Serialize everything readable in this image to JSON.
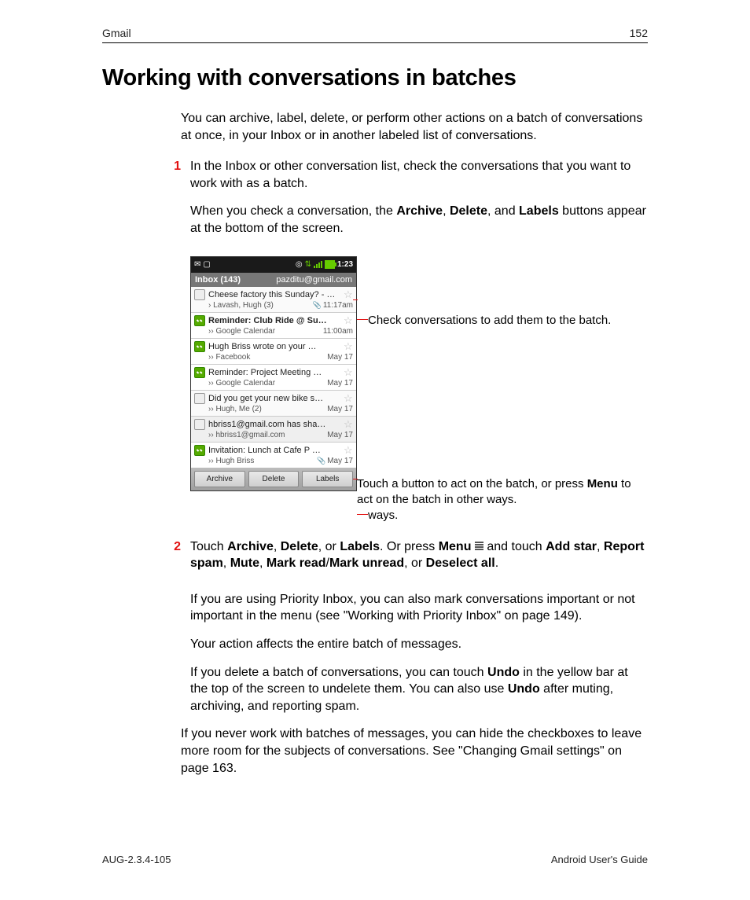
{
  "header": {
    "section": "Gmail",
    "page_number": "152"
  },
  "title": "Working with conversations in batches",
  "intro": "You can archive, label, delete, or perform other actions on a batch of conversations at once, in your Inbox or in another labeled list of conversations.",
  "step1": {
    "num": "1",
    "text": "In the Inbox or other conversation list, check the conversations that you want to work with as a batch.",
    "follow_a": "When you check a conversation, the ",
    "follow_b": "Archive",
    "follow_c": ", ",
    "follow_d": "Delete",
    "follow_e": ", and ",
    "follow_f": "Labels",
    "follow_g": " buttons appear at the bottom of the screen."
  },
  "callouts": {
    "c1": "Check conversations to add them to the batch.",
    "c2a": "Touch a button to act on the batch, or press ",
    "c2b": "Menu",
    "c2c": " to act on the batch in other ways."
  },
  "step2": {
    "num": "2",
    "a": "Touch ",
    "b": "Archive",
    "c": ", ",
    "d": "Delete",
    "e": ", or ",
    "f": "Labels",
    "g": ". Or press ",
    "h": "Menu",
    "i": " ",
    "j": " and touch ",
    "k": "Add star",
    "l": ", ",
    "m": "Report spam",
    "n": ", ",
    "o": "Mute",
    "p": ", ",
    "q": "Mark read",
    "r": "/",
    "s": "Mark unread",
    "t": ", or ",
    "u": "Deselect all",
    "v": "."
  },
  "after1": "If you are using Priority Inbox, you can also mark conversations important or not important in the menu (see \"Working with Priority Inbox\" on page 149).",
  "after2": "Your action affects the entire batch of messages.",
  "after3a": "If you delete a batch of conversations, you can touch ",
  "after3b": "Undo",
  "after3c": " in the yellow bar at the top of the screen to undelete them. You can also use ",
  "after3d": "Undo",
  "after3e": " after muting, archiving, and reporting spam.",
  "tail": "If you never work with batches of messages, you can hide the checkboxes to leave more room for the subjects of conversations. See \"Changing Gmail settings\" on page 163.",
  "footer": {
    "left": "AUG-2.3.4-105",
    "right": "Android User's Guide"
  },
  "phone": {
    "time": "1:23",
    "inbox_label": "Inbox (143)",
    "account": "pazditu@gmail.com",
    "rows": [
      {
        "checked": false,
        "bold": false,
        "subject": "Cheese factory this Sunday? - …",
        "from": "› Lavash, Hugh (3)",
        "time": "11:17am",
        "clip": true,
        "mark": true
      },
      {
        "checked": true,
        "bold": true,
        "subject": "Reminder: Club Ride @ Su…",
        "from": "›› Google Calendar",
        "time": "11:00am",
        "clip": false,
        "mark": false
      },
      {
        "checked": true,
        "bold": false,
        "subject": "Hugh Briss wrote on your …",
        "from": "›› Facebook",
        "time": "May 17",
        "clip": false,
        "mark": false
      },
      {
        "checked": true,
        "bold": false,
        "subject": "Reminder: Project Meeting …",
        "from": "›› Google Calendar",
        "time": "May 17",
        "clip": false,
        "mark": false
      },
      {
        "checked": false,
        "bold": false,
        "subject": "Did you get your new bike s…",
        "from": "›› Hugh, Me (2)",
        "time": "May 17",
        "clip": false,
        "mark": false
      },
      {
        "checked": false,
        "bold": false,
        "subject": "hbriss1@gmail.com has sha…",
        "from": "›› hbriss1@gmail.com",
        "time": "May 17",
        "clip": false,
        "mark": false
      },
      {
        "checked": true,
        "bold": false,
        "subject": "Invitation: Lunch at Cafe P …",
        "from": "›› Hugh Briss",
        "time": "May 17",
        "clip": true,
        "mark": false
      }
    ],
    "actions": {
      "archive": "Archive",
      "delete": "Delete",
      "labels": "Labels"
    }
  }
}
